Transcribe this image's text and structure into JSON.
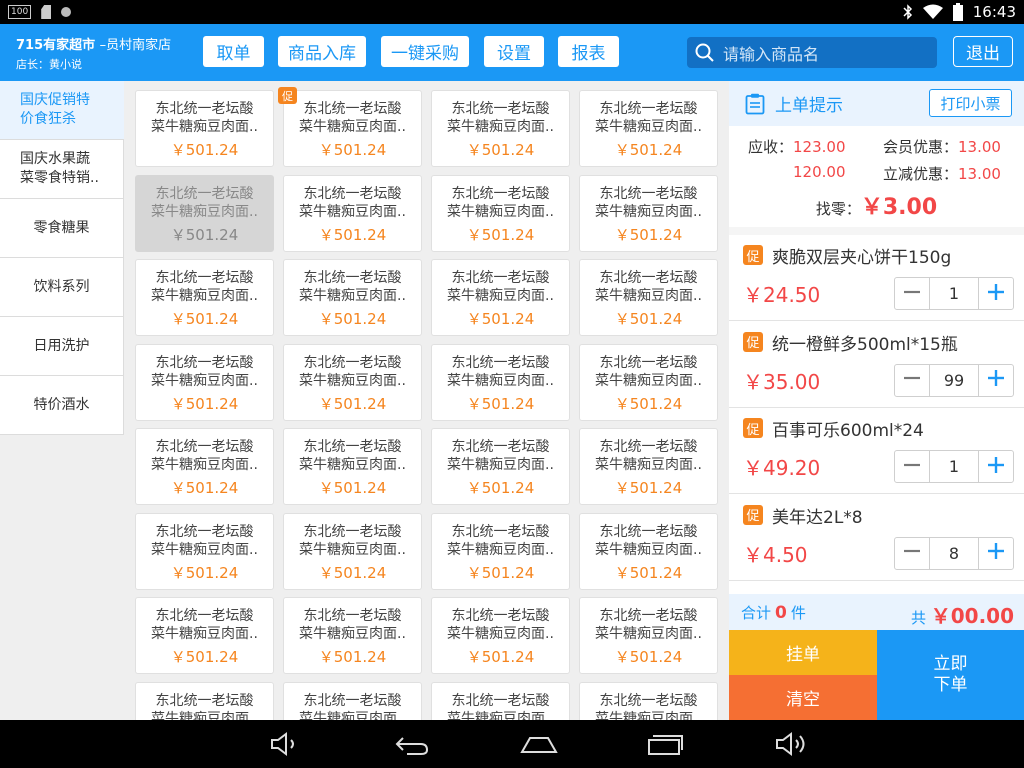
{
  "status_bar": {
    "time": "16:43",
    "left_badge": "100"
  },
  "header": {
    "store_name": "715有家超市",
    "branch": "–员村南家店",
    "manager": "店长：黄小说",
    "buttons": [
      "取单",
      "商品入库",
      "一键采购",
      "设置",
      "报表"
    ],
    "search_placeholder": "请输入商品名",
    "logout": "退出",
    "accent": "#1b98f5"
  },
  "categories": [
    {
      "line1": "国庆促销特",
      "line2": "价食狂杀",
      "active": true
    },
    {
      "line1": "国庆水果蔬",
      "line2": "菜零食特销..",
      "active": false
    },
    {
      "line1": "零食糖果",
      "line2": "",
      "active": false
    },
    {
      "line1": "饮料系列",
      "line2": "",
      "active": false
    },
    {
      "line1": "日用洗护",
      "line2": "",
      "active": false
    },
    {
      "line1": "特价酒水",
      "line2": "",
      "active": false
    }
  ],
  "product": {
    "name_line1": "东北统一老坛酸",
    "name_line2": "菜牛糖痴豆肉面..",
    "price": "￥501.24",
    "promo_tag": "促"
  },
  "order_panel": {
    "title": "上单提示",
    "print": "打印小票",
    "receivable_label": "应收：",
    "receivable": "123.00",
    "member_label": "会员优惠：",
    "member_discount": "13.00",
    "paid": "120.00",
    "instant_label": "立减优惠：",
    "instant_discount": "13.00",
    "change_label": "找零：",
    "change": "￥3.00"
  },
  "cart": [
    {
      "tag": "促",
      "name": "爽脆双层夹心饼干150g",
      "price": "￥24.50",
      "qty": "1"
    },
    {
      "tag": "促",
      "name": "统一橙鲜多500ml*15瓶",
      "price": "￥35.00",
      "qty": "99"
    },
    {
      "tag": "促",
      "name": "百事可乐600ml*24",
      "price": "￥49.20",
      "qty": "1"
    },
    {
      "tag": "促",
      "name": "美年达2L*8",
      "price": "￥4.50",
      "qty": "8"
    }
  ],
  "totals": {
    "count_prefix": "合计",
    "count": "0",
    "count_suffix": "件",
    "sum_prefix": "共",
    "sum": "￥00.00"
  },
  "actions": {
    "hold": "挂单",
    "clear": "清空",
    "order_line1": "立即",
    "order_line2": "下单"
  }
}
